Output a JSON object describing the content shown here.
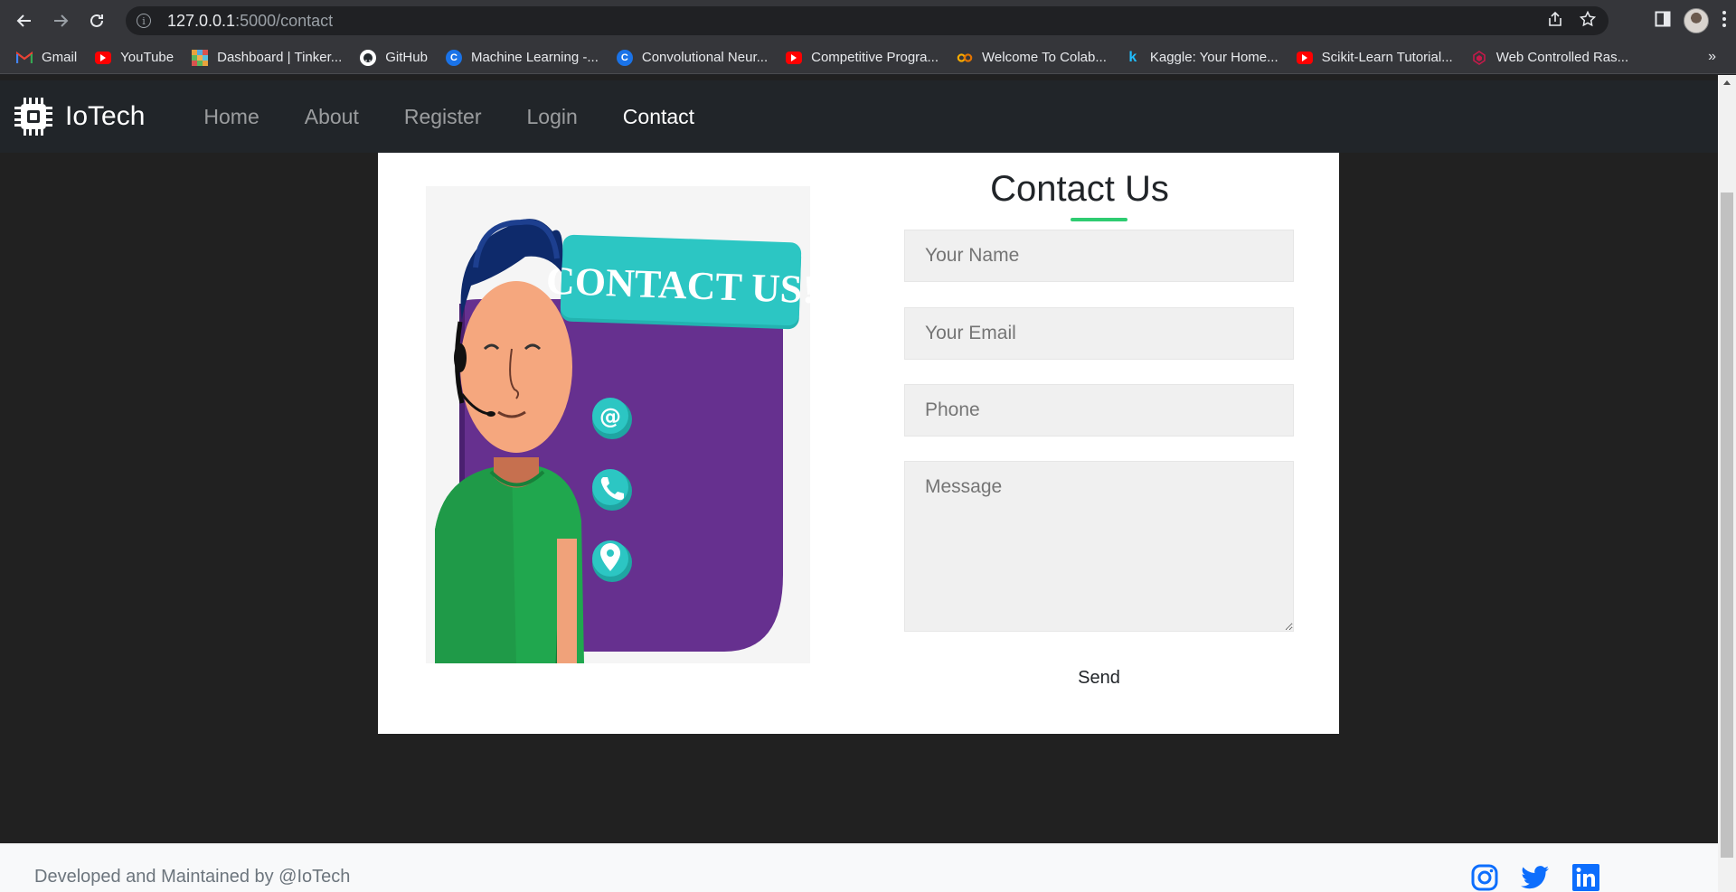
{
  "browser": {
    "url_host": "127.0.0.1",
    "url_path": ":5000/contact",
    "bookmarks": [
      {
        "label": "Gmail",
        "icon": "gmail-icon",
        "color": "#ea4335"
      },
      {
        "label": "YouTube",
        "icon": "youtube-icon",
        "color": "#ff0000"
      },
      {
        "label": "Dashboard | Tinker...",
        "icon": "tinkercad-icon",
        "color": "#e8a33d"
      },
      {
        "label": "GitHub",
        "icon": "github-icon",
        "color": "#ffffff"
      },
      {
        "label": "Machine Learning -...",
        "icon": "coursera-icon",
        "color": "#1a73e8"
      },
      {
        "label": "Convolutional Neur...",
        "icon": "coursera-icon",
        "color": "#1a73e8"
      },
      {
        "label": "Competitive Progra...",
        "icon": "youtube-icon",
        "color": "#ff0000"
      },
      {
        "label": "Welcome To Colab...",
        "icon": "colab-icon",
        "color": "#f9ab00"
      },
      {
        "label": "Kaggle: Your Home...",
        "icon": "kaggle-icon",
        "color": "#20beff"
      },
      {
        "label": "Scikit-Learn Tutorial...",
        "icon": "youtube-icon",
        "color": "#ff0000"
      },
      {
        "label": "Web Controlled Ras...",
        "icon": "raspberry-icon",
        "color": "#c51a4a"
      }
    ],
    "more": "»"
  },
  "navbar": {
    "brand": "IoTech",
    "links": [
      "Home",
      "About",
      "Register",
      "Login",
      "Contact"
    ],
    "active": "Contact"
  },
  "illustration": {
    "banner": "CONTACT US!",
    "icons": [
      "@",
      "phone",
      "location"
    ]
  },
  "form": {
    "title": "Contact Us",
    "name_placeholder": "Your Name",
    "email_placeholder": "Your Email",
    "phone_placeholder": "Phone",
    "message_placeholder": "Message",
    "send_label": "Send",
    "accent": "#2ecc71"
  },
  "footer": {
    "text": "Developed and Maintained by @IoTech",
    "socials": [
      "instagram-icon",
      "twitter-icon",
      "linkedin-icon"
    ],
    "social_color": "#0d6efd"
  }
}
